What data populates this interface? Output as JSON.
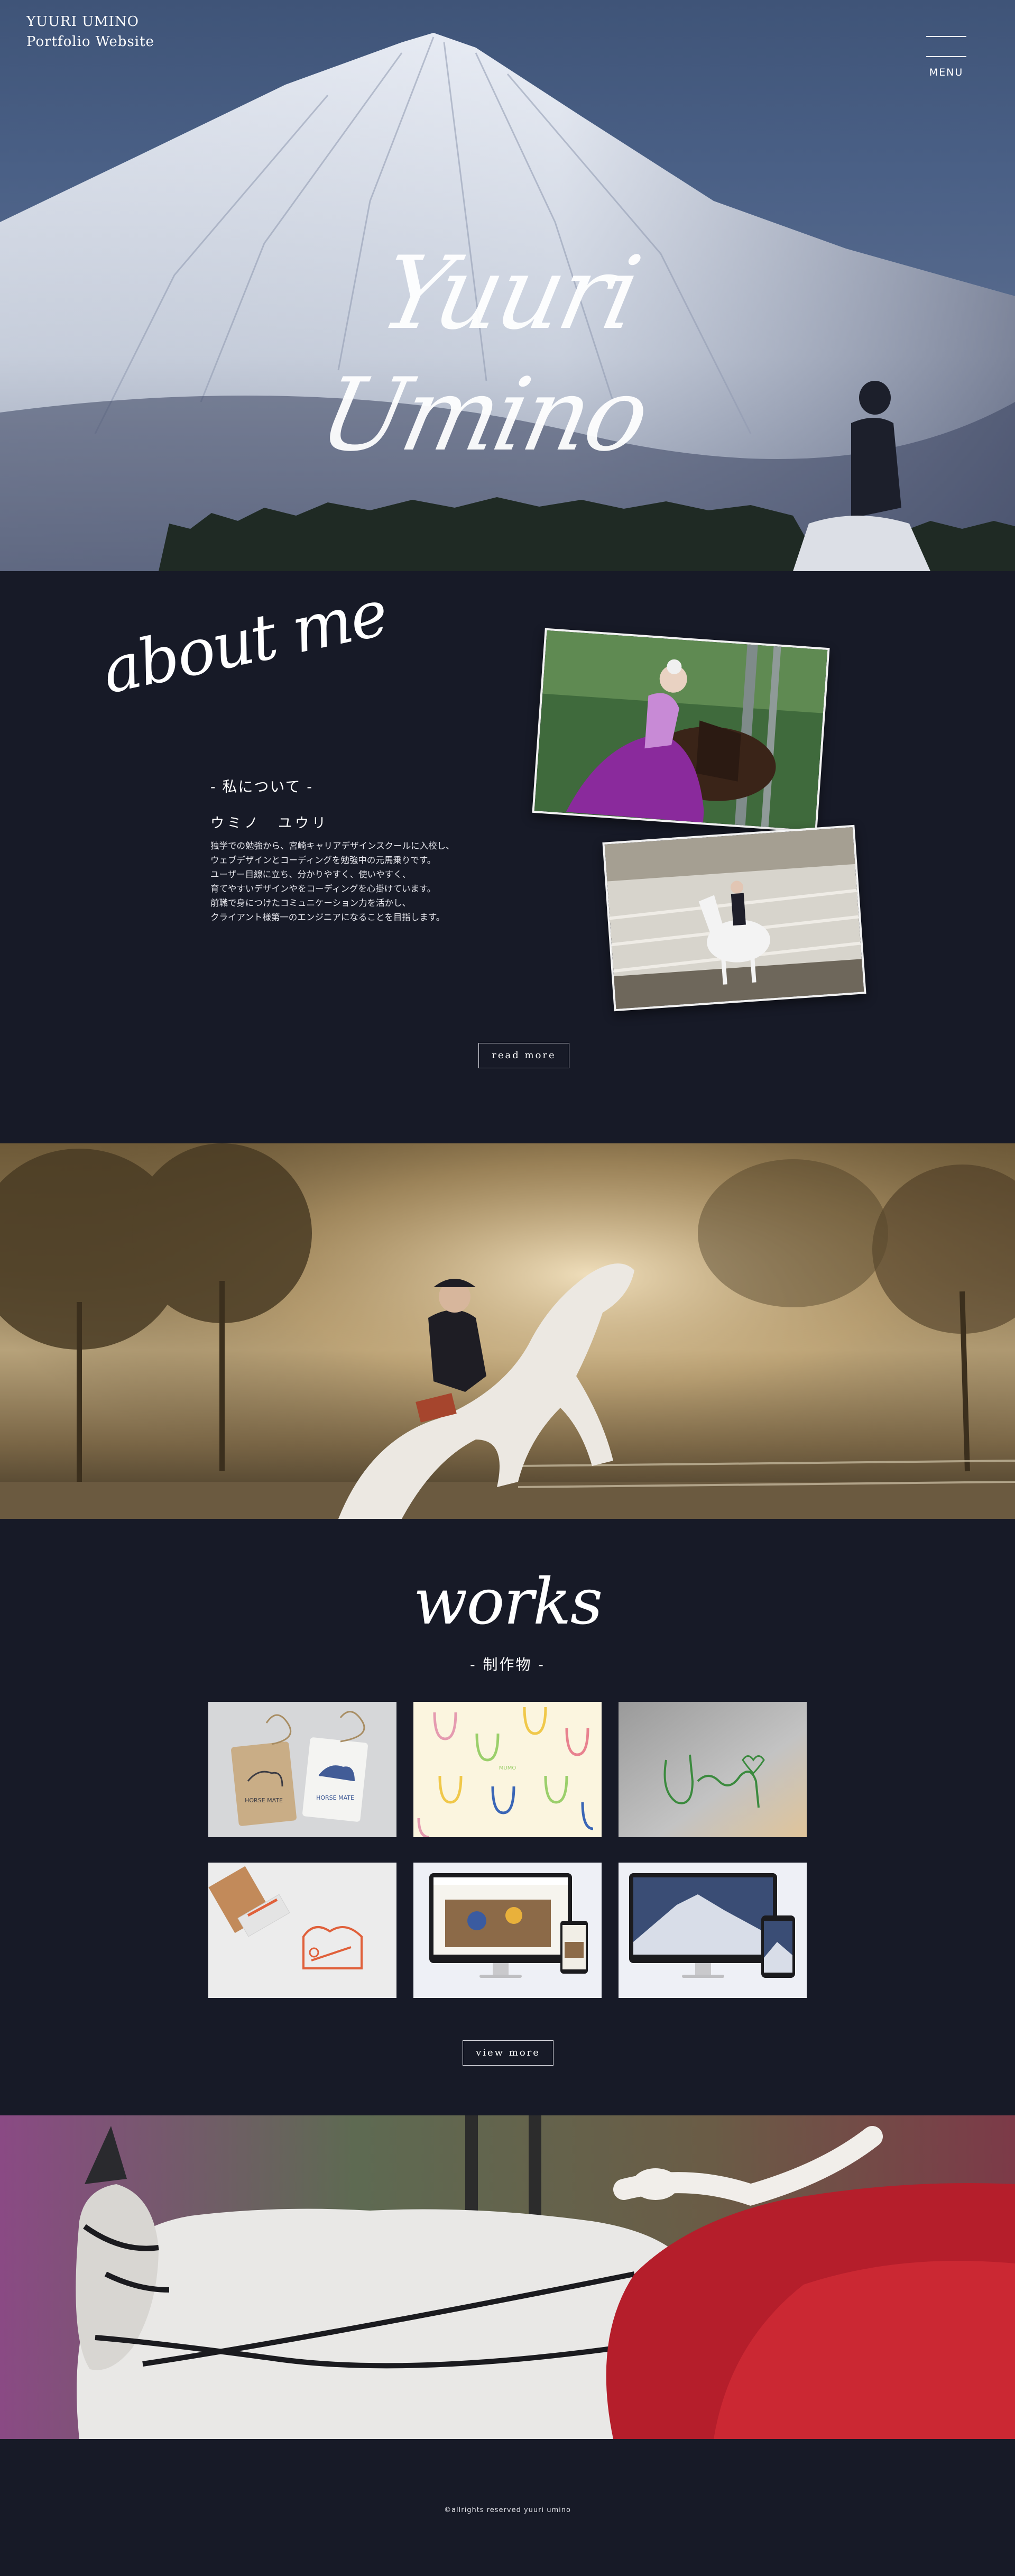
{
  "header": {
    "site_title": "YUURI UMINO",
    "site_subtitle": "Portfolio Website",
    "menu_label": "MENU"
  },
  "hero": {
    "signature": "Yuuri Umino"
  },
  "about": {
    "signature": "about me",
    "subtitle": "- 私について -",
    "name": "ウミノ　ユウリ",
    "body_lines": [
      "独学での勉強から、宮崎キャリアデザインスクールに入校し、",
      "ウェブデザインとコーディングを勉強中の元馬乗りです。",
      "ユーザー目線に立ち、分かりやすく、使いやすく、",
      "育てやすいデザインやをコーディングを心掛けています。",
      "前職で身につけたコミュニケーション力を活かし、",
      "クライアント様第一のエンジニアになることを目指します。"
    ],
    "read_more": "read more"
  },
  "works": {
    "signature": "works",
    "subtitle": "- 制作物 -",
    "tiles": [
      {
        "name": "horse-mate-tags",
        "logo_text": "HORSE MATE"
      },
      {
        "name": "horseshoe-pattern",
        "logo_text": "MUMO"
      },
      {
        "name": "horse-line-logo",
        "logo_text": ""
      },
      {
        "name": "stamp-mockup",
        "logo_text": ""
      },
      {
        "name": "website-mockup-1",
        "logo_text": ""
      },
      {
        "name": "website-mockup-2",
        "logo_text": ""
      }
    ],
    "view_more": "view more"
  },
  "footer": {
    "copyright": "©allrights reserved yuuri umino"
  },
  "colors": {
    "page_background": "#171a27",
    "text": "#ffffff",
    "button_border": "#d9d9e0"
  }
}
